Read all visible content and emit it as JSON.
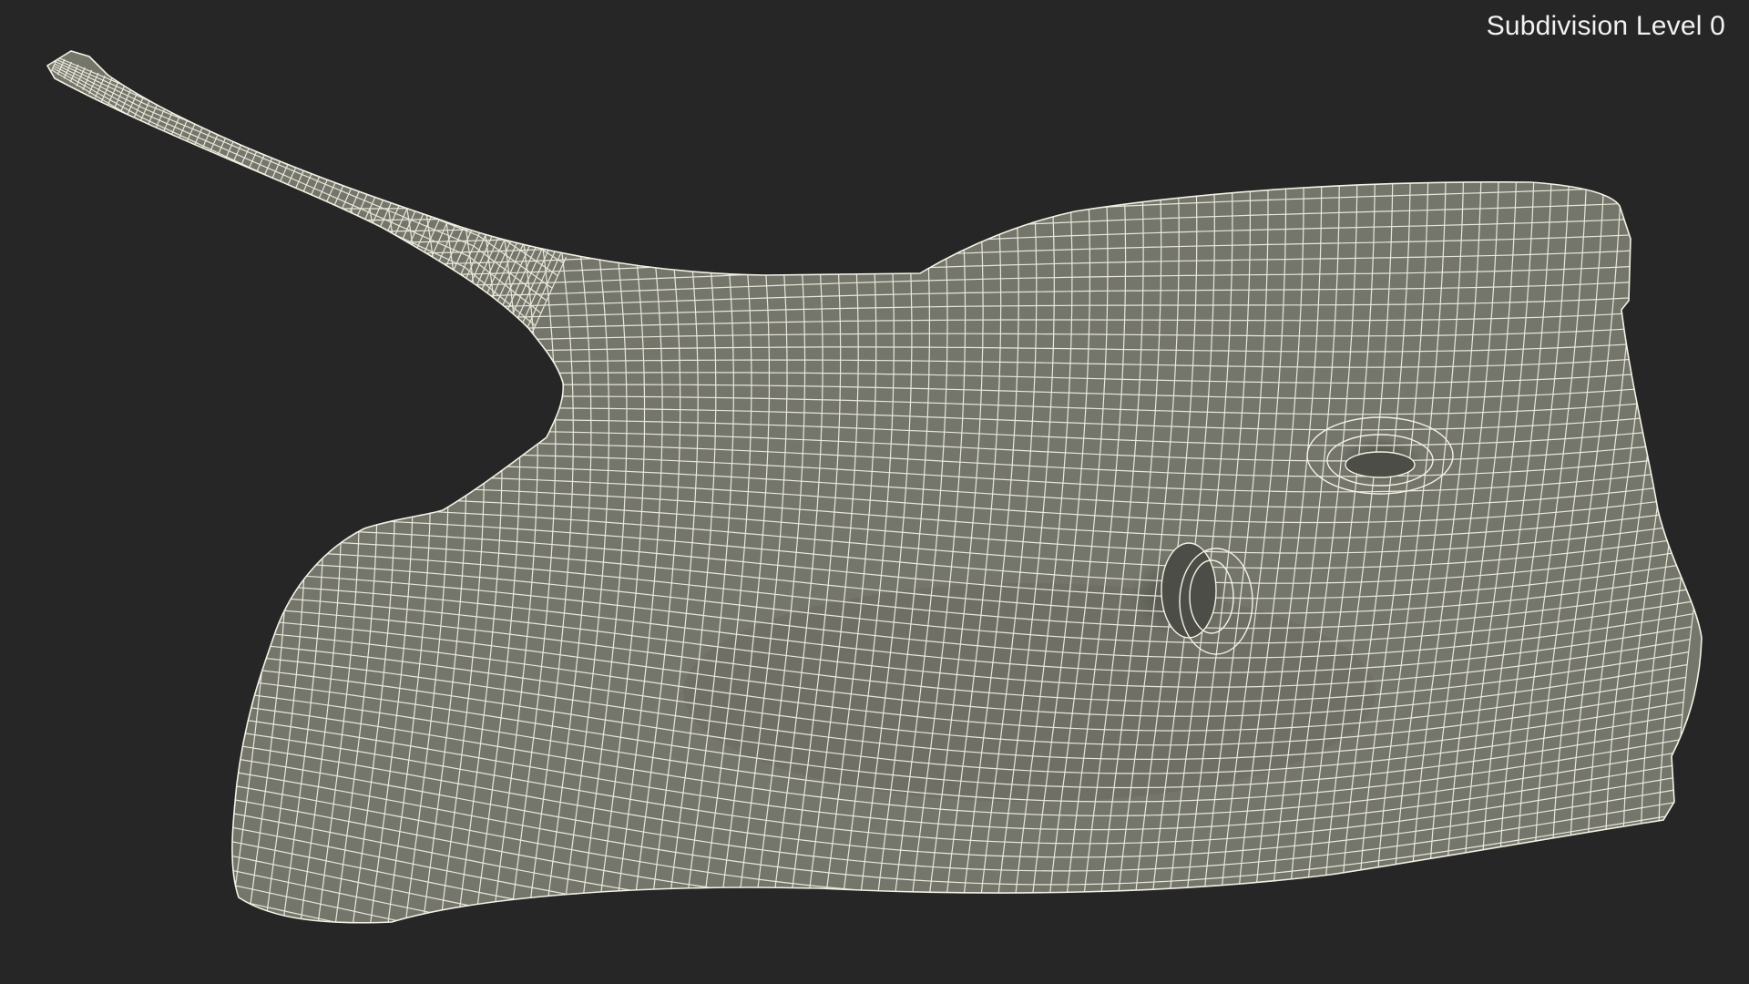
{
  "viewport": {
    "overlay_label": "Subdivision Level 0",
    "background_color": "#262626",
    "mesh_fill_color": "#74756b",
    "wire_color": "#f4f1e4",
    "object": "stingray"
  }
}
